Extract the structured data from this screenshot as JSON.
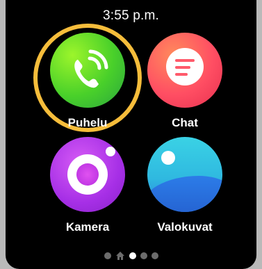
{
  "status": {
    "time": "3:55 p.m."
  },
  "apps": [
    {
      "label": "Puhelu",
      "icon": "phone-icon"
    },
    {
      "label": "Chat",
      "icon": "chat-icon"
    },
    {
      "label": "Kamera",
      "icon": "camera-icon"
    },
    {
      "label": "Valokuvat",
      "icon": "photos-icon"
    }
  ],
  "pager": {
    "pages": 5,
    "home_index": 1,
    "active_index": 2
  },
  "colors": {
    "focus_ring": "#f6bd3b",
    "background": "#000000"
  }
}
